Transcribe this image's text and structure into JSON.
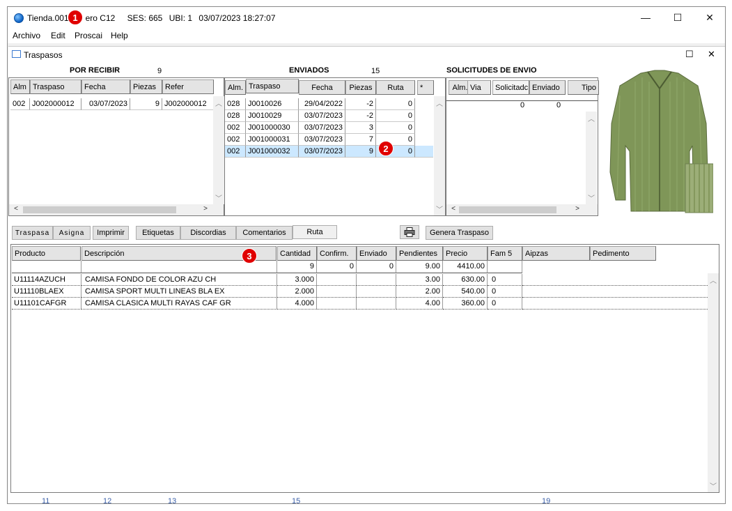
{
  "window": {
    "title_a": "Tienda.001",
    "title_b": "ero C12",
    "ses": "SES: 665",
    "ubi": "UBI: 1",
    "datetime": "03/07/2023 18:27:07",
    "minimize": "—",
    "maximize": "☐",
    "close": "✕"
  },
  "menu": [
    "Archivo",
    "Edit",
    "Proscai",
    "Help"
  ],
  "child": {
    "title": "Traspasos",
    "maximize": "☐",
    "close": "✕"
  },
  "por_recibir": {
    "title": "POR RECIBIR",
    "count": "9",
    "headers": [
      "Alm",
      "Traspaso",
      "Fecha",
      "Piezas",
      "Refer"
    ],
    "rows": [
      [
        "002",
        "J002000012",
        "03/07/2023",
        "9",
        "J002000012"
      ]
    ]
  },
  "enviados": {
    "title": "ENVIADOS",
    "count": "15",
    "headers": [
      "Alm.",
      "Traspaso",
      "Fecha",
      "Piezas",
      "Ruta",
      "*"
    ],
    "rows": [
      [
        "028",
        "J0010026",
        "29/04/2022",
        "-2",
        "0"
      ],
      [
        "028",
        "J0010029",
        "03/07/2023",
        "-2",
        "0"
      ],
      [
        "002",
        "J001000030",
        "03/07/2023",
        "3",
        "0"
      ],
      [
        "002",
        "J001000031",
        "03/07/2023",
        "7",
        "0"
      ],
      [
        "002",
        "J001000032",
        "03/07/2023",
        "9",
        "0"
      ]
    ]
  },
  "solicitudes": {
    "title": "SOLICITUDES DE ENVIO",
    "headers": [
      "Alm.",
      "Via",
      "Solicitadc",
      "Enviado",
      "Tipo"
    ],
    "totals": [
      "0",
      "0"
    ]
  },
  "toolbar": {
    "traspasa": "Traspasa",
    "asigna": "Asigna",
    "imprimir": "Imprimir",
    "etiquetas": "Etiquetas",
    "discordias": "Discordias",
    "comentarios": "Comentarios",
    "ruta": "Ruta",
    "print_icon": "printer-icon",
    "genera": "Genera Traspaso"
  },
  "detail": {
    "headers": [
      "Producto",
      "Descripción",
      "Cantidad",
      "Confirm.",
      "Enviado",
      "Pendientes",
      "Precio",
      "Fam 5",
      "Aipzas",
      "Pedimento"
    ],
    "totals": [
      "9",
      "0",
      "0",
      "9.00",
      "4410.00"
    ],
    "rows": [
      [
        "U11114AZUCH",
        "CAMISA FONDO DE COLOR AZU CH",
        "3.000",
        "",
        "",
        "3.00",
        "630.00",
        "0"
      ],
      [
        "U11110BLAEX",
        "CAMISA SPORT MULTI LINEAS BLA EX",
        "2.000",
        "",
        "",
        "2.00",
        "540.00",
        "0"
      ],
      [
        "U11101CAFGR",
        "CAMISA CLASICA MULTI RAYAS CAF GR",
        "4.000",
        "",
        "",
        "4.00",
        "360.00",
        "0"
      ]
    ]
  },
  "markers": [
    "1",
    "2",
    "3"
  ],
  "bottom_ticks": [
    "11",
    "12",
    "13",
    "15",
    "19"
  ]
}
